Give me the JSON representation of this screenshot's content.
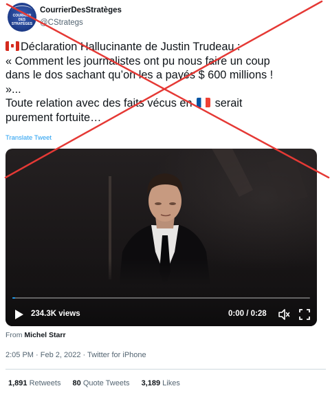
{
  "author": {
    "display_name": "CourrierDesStratèges",
    "handle": "@CStrategs",
    "avatar_lines": [
      "COURRIER",
      "DES",
      "STRATÈGES"
    ]
  },
  "tweet": {
    "line1": "Déclaration Hallucinante de Justin Trudeau :",
    "line2": "« Comment les journalistes ont pu nous faire un coup",
    "line3": "dans le dos sachant qu’on les a payés $ 600 millions !",
    "line4": "»...",
    "line5a": "Toute relation avec des faits vécus en",
    "line5b": "serait",
    "line6": "purement fortuite…",
    "translate_label": "Translate Tweet"
  },
  "video": {
    "views": "234.3K views",
    "time": "0:00 / 0:28",
    "progress_fraction": 0.01
  },
  "attribution": {
    "prefix": "From",
    "source": "Michel Starr"
  },
  "timestamp": "2:05 PM · Feb 2, 2022 · Twitter for iPhone",
  "stats": {
    "retweets_count": "1,891",
    "retweets_label": "Retweets",
    "quote_count": "80",
    "quote_label": "Quote Tweets",
    "likes_count": "3,189",
    "likes_label": "Likes"
  },
  "colors": {
    "accent": "#1d9bf0",
    "cross": "#e53935",
    "text": "#0f1419",
    "muted": "#536471"
  },
  "icons": [
    "canada-flag-icon",
    "france-flag-icon",
    "play-icon",
    "volume-icon",
    "fullscreen-icon"
  ]
}
